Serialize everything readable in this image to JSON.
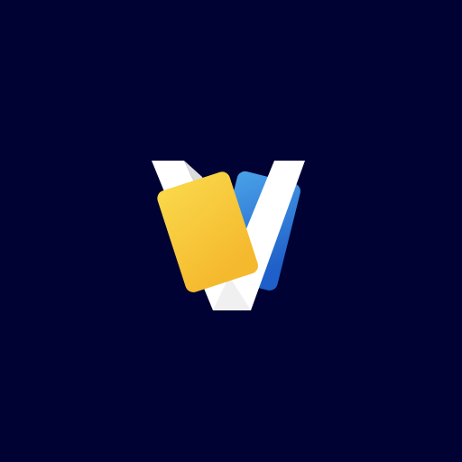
{
  "app_icon": {
    "icon": "v-cards-logo-icon",
    "colors": {
      "background": "#000233",
      "v_letter": "#ffffff",
      "v_fold_shade": "#dcdcdc",
      "yellow_card_top": "#fad84a",
      "yellow_card_bottom": "#f5b92e",
      "blue_card_top": "#4aa3e8",
      "blue_card_bottom": "#1f5fc9"
    }
  }
}
